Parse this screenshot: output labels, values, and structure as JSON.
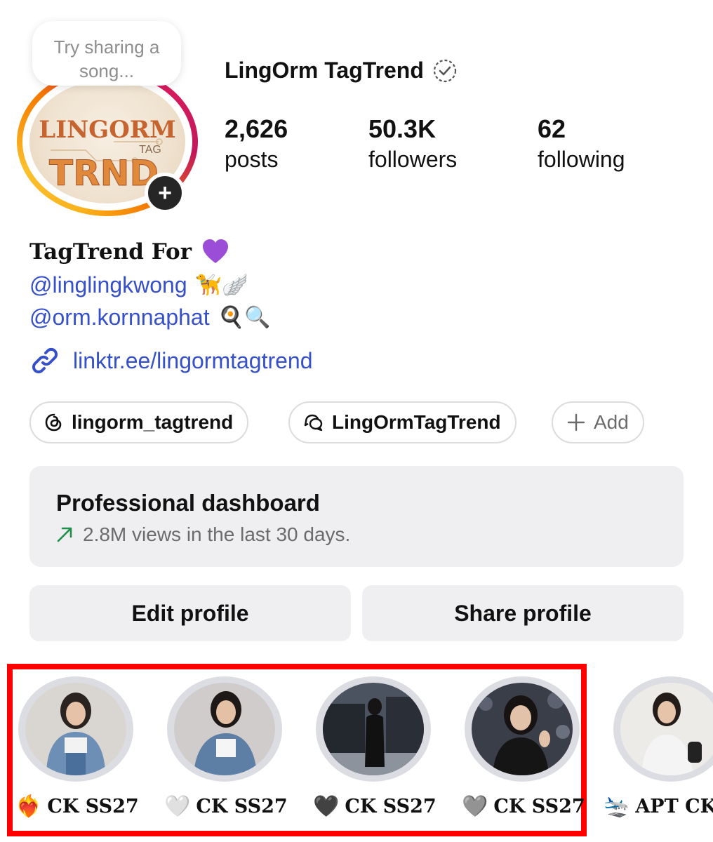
{
  "profile": {
    "username": "LingOrm TagTrend",
    "note": "Try sharing a song...",
    "avatar_logo_line1": "LINGORM",
    "avatar_logo_tag": "TAG",
    "avatar_logo_line2": "TRND",
    "stats": [
      {
        "value": "2,626",
        "label": "posts"
      },
      {
        "value": "50.3K",
        "label": "followers"
      },
      {
        "value": "62",
        "label": "following"
      }
    ]
  },
  "bio": {
    "name": "TagTrend For",
    "mention1": "@linglingkwong",
    "mention1_emoji": "🦮🪽",
    "mention2": "@orm.kornnaphat",
    "mention2_emoji": "🍳🔍",
    "link": "linktr.ee/lingormtagtrend"
  },
  "chips": {
    "threads": "lingorm_tagtrend",
    "messenger": "LingOrmTagTrend",
    "add": "Add"
  },
  "dashboard": {
    "title": "Professional dashboard",
    "subtitle": "2.8M views in the last 30 days."
  },
  "buttons": {
    "edit": "Edit profile",
    "share": "Share profile"
  },
  "highlights": [
    {
      "emoji": "❤️‍🔥",
      "label": "CK SS27"
    },
    {
      "emoji": "🤍",
      "label": "CK SS27"
    },
    {
      "emoji": "🖤",
      "label": "CK SS27"
    },
    {
      "emoji": "🩶",
      "label": "CK SS27"
    },
    {
      "emoji": "🛬",
      "label": "APT CK"
    }
  ],
  "colors": {
    "link_blue": "#3550c8",
    "highlight_border": "#ff0000",
    "surface_gray": "#efeff1"
  }
}
